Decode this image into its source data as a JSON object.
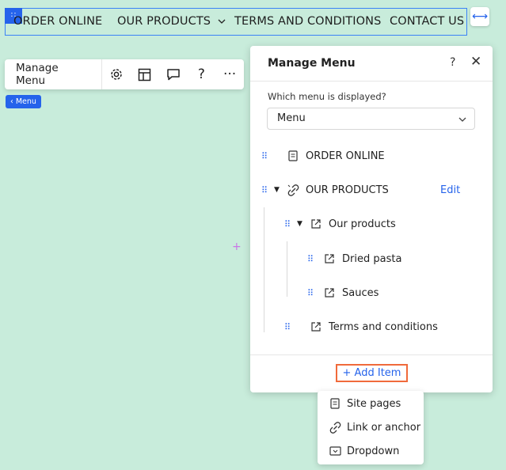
{
  "nav": {
    "items": [
      "ORDER ONLINE",
      "OUR PRODUCTS",
      "TERMS AND CONDITIONS",
      "CONTACT US"
    ],
    "handle_icon": "drag-grid-icon",
    "stretch_icon": "horizontal-stretch-icon"
  },
  "toolbar": {
    "manage_label": "Manage Menu",
    "buttons": [
      "gear-icon",
      "layout-icon",
      "comment-icon",
      "help-icon",
      "more-icon"
    ]
  },
  "element_tag": "‹ Menu",
  "panel": {
    "title": "Manage Menu",
    "help": "?",
    "close": "✕",
    "which_label": "Which menu is displayed?",
    "selected_menu": "Menu",
    "edit_label": "Edit",
    "items": [
      {
        "label": "ORDER ONLINE",
        "icon": "page-icon"
      },
      {
        "label": "OUR PRODUCTS",
        "icon": "unlink-icon"
      },
      {
        "label": "Our products",
        "icon": "external-link-icon"
      },
      {
        "label": "Dried pasta",
        "icon": "external-link-icon"
      },
      {
        "label": "Sauces",
        "icon": "external-link-icon"
      },
      {
        "label": "Terms and conditions",
        "icon": "external-link-icon"
      }
    ],
    "add_item": "+ Add Item"
  },
  "dropdown": {
    "items": [
      {
        "label": "Site pages",
        "icon": "page-icon"
      },
      {
        "label": "Link or anchor",
        "icon": "link-icon"
      },
      {
        "label": "Dropdown",
        "icon": "dropdown-icon"
      }
    ]
  },
  "colors": {
    "background": "#c8ecdb",
    "accent": "#2563eb",
    "highlight": "#f06a3b"
  }
}
